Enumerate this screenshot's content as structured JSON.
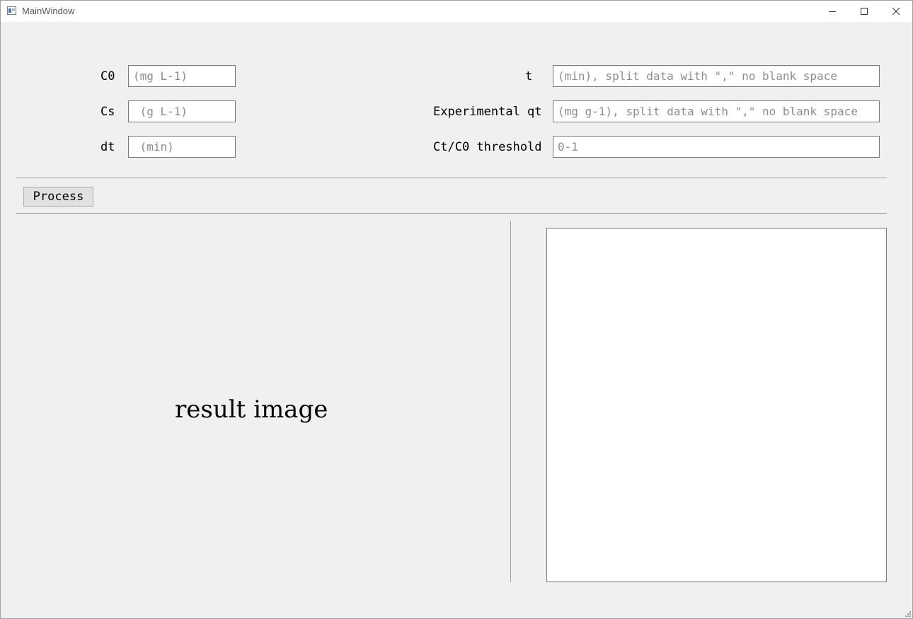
{
  "window": {
    "title": "MainWindow"
  },
  "form": {
    "c0": {
      "label": "C0",
      "placeholder": "(mg L-1)",
      "value": ""
    },
    "cs": {
      "label": "Cs",
      "placeholder": " (g L-1)",
      "value": ""
    },
    "dt": {
      "label": "dt",
      "placeholder": " (min)",
      "value": ""
    },
    "t": {
      "label": "t",
      "placeholder": "(min), split data with \",\" no blank space",
      "value": ""
    },
    "qt": {
      "label": "Experimental qt",
      "placeholder": "(mg g-1), split data with \",\" no blank space",
      "value": ""
    },
    "threshold": {
      "label": "Ct/C0 threshold",
      "placeholder": "0-1",
      "value": ""
    }
  },
  "actions": {
    "process_label": "Process"
  },
  "result": {
    "label": "result image"
  },
  "icons": {
    "app": "app-window-icon",
    "minimize": "minimize-icon",
    "maximize": "maximize-icon",
    "close": "close-icon",
    "grip": "size-grip-icon"
  }
}
